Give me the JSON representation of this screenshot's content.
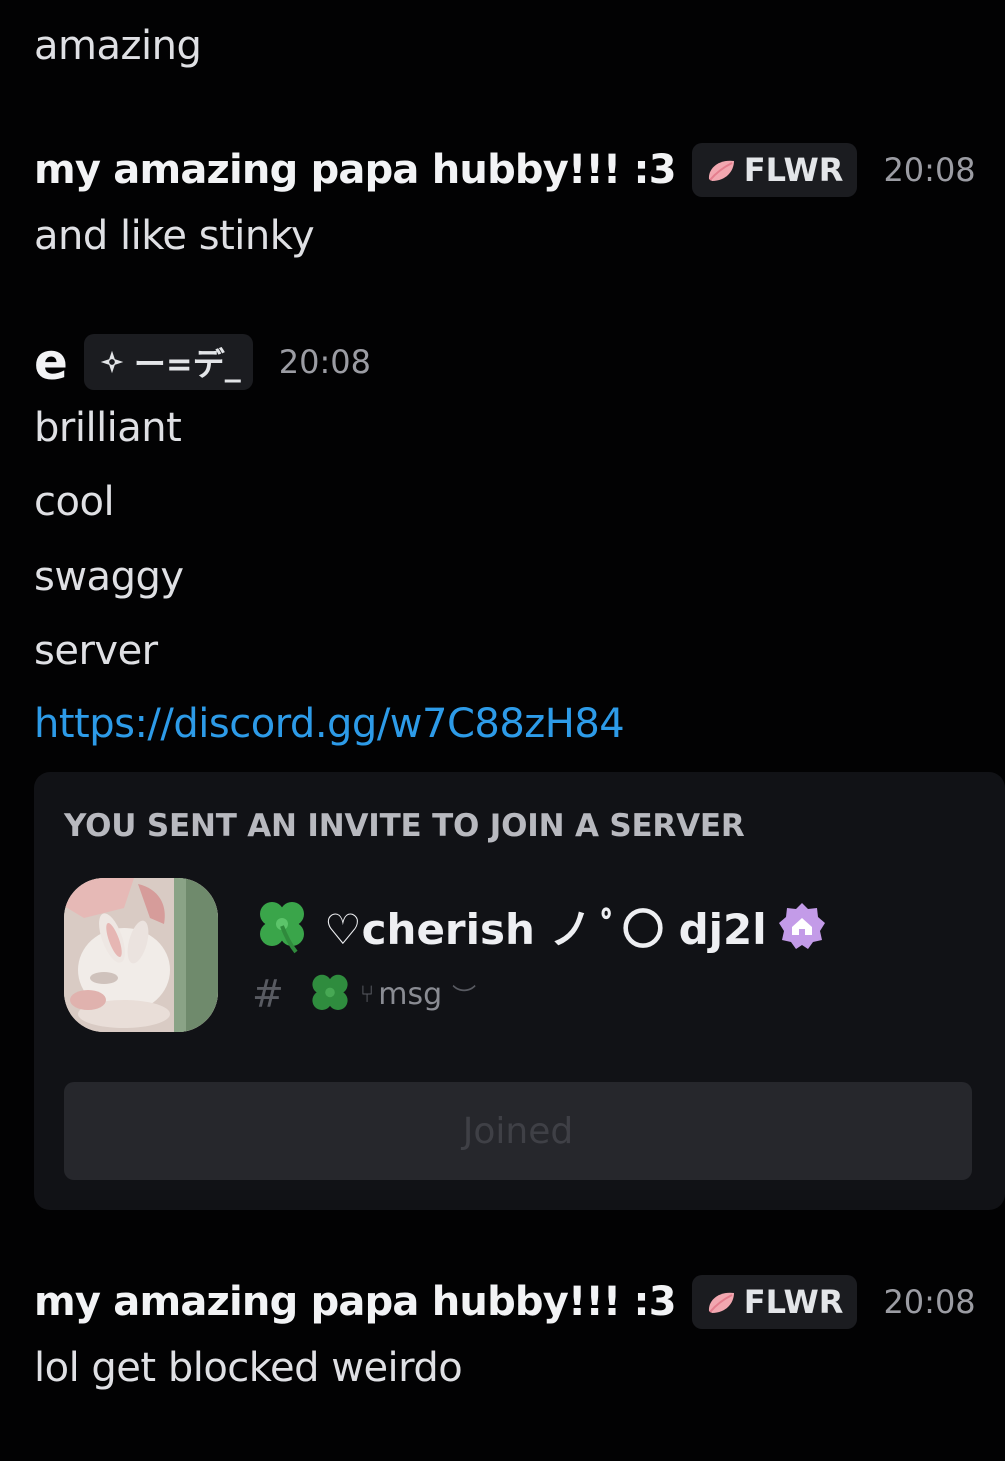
{
  "colors": {
    "background": "#020203",
    "text": "#dfe0e4",
    "link": "#2d9be8",
    "card": "#111216",
    "tag_bg": "#1b1c20",
    "timestamp": "#9b9ca3"
  },
  "messages": [
    {
      "continuation_lines": [
        "amazing"
      ]
    },
    {
      "author": "my amazing papa hubby!!! :3",
      "tag": {
        "icon": "petal-icon",
        "label": "FLWR"
      },
      "timestamp": "20:08",
      "lines": [
        "and like stinky"
      ]
    },
    {
      "author": "e",
      "tag": {
        "icon": "sparkle-icon",
        "label": "ー=デ_"
      },
      "timestamp": "20:08",
      "lines": [
        "brilliant",
        "cool",
        "swaggy",
        "server"
      ],
      "link": "https://discord.gg/w7C88zH84",
      "invite": {
        "heading": "YOU SENT AN INVITE TO JOIN A SERVER",
        "server_name": "♡cherish ノ ﾟ〇 dj2l",
        "server_name_prefix_icon": "clover-icon",
        "server_badge_icon": "community-badge-icon",
        "channel_hash": "#",
        "channel_name": "msg",
        "channel_prefix": "⑂",
        "button_label": "Joined"
      }
    },
    {
      "author": "my amazing papa hubby!!! :3",
      "tag": {
        "icon": "petal-icon",
        "label": "FLWR"
      },
      "timestamp": "20:08",
      "lines": [
        "lol get blocked weirdo"
      ]
    }
  ]
}
